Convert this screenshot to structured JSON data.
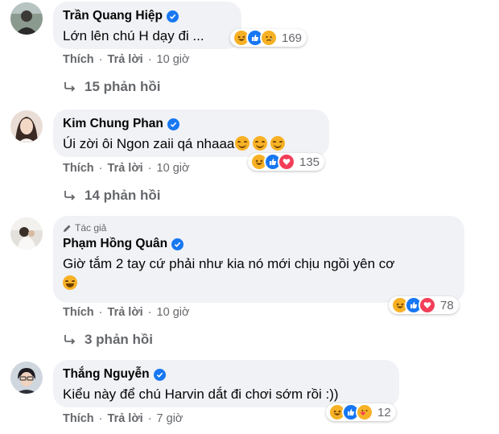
{
  "comments": [
    {
      "author": "Trần Quang Hiệp",
      "verified": true,
      "text": "Lớn lên chú H dạy đi ...",
      "reactions": [
        "haha",
        "like",
        "sad"
      ],
      "reaction_count": "169",
      "actions": {
        "like": "Thích",
        "reply": "Trả lời",
        "time": "10 giờ"
      },
      "replies": "15 phản hồi"
    },
    {
      "author": "Kim Chung Phan",
      "verified": true,
      "text": "Úi zời ôi Ngon zaii qá nhaaa",
      "inline_emoji": [
        "smiling-face",
        "smiling-face",
        "smiling-face"
      ],
      "reactions": [
        "haha",
        "like",
        "love"
      ],
      "reaction_count": "135",
      "actions": {
        "like": "Thích",
        "reply": "Trả lời",
        "time": "10 giờ"
      },
      "replies": "14 phản hồi"
    },
    {
      "author_tag": "Tác giả",
      "author": "Phạm Hồng Quân",
      "verified": true,
      "text": "Giờ tắm 2 tay cứ phải như kia nó mới chịu ngồi yên cơ",
      "inline_emoji": [
        "laughing-face"
      ],
      "reactions": [
        "haha",
        "like",
        "love"
      ],
      "reaction_count": "78",
      "actions": {
        "like": "Thích",
        "reply": "Trả lời",
        "time": "10 giờ"
      },
      "replies": "3 phản hồi"
    },
    {
      "author": "Thắng Nguyễn",
      "verified": true,
      "text": "Kiểu này để chú Harvin dắt đi chơi sớm rồi :))",
      "reactions": [
        "haha",
        "like",
        "care"
      ],
      "reaction_count": "12",
      "actions": {
        "like": "Thích",
        "reply": "Trả lời",
        "time": "7 giờ"
      }
    }
  ],
  "colors": {
    "bubble": "#f0f2f5",
    "secondary_text": "#65676b",
    "verified": "#1877f2",
    "like": "#1877f2",
    "love": "#f33e58",
    "haha": "#f7b125"
  }
}
